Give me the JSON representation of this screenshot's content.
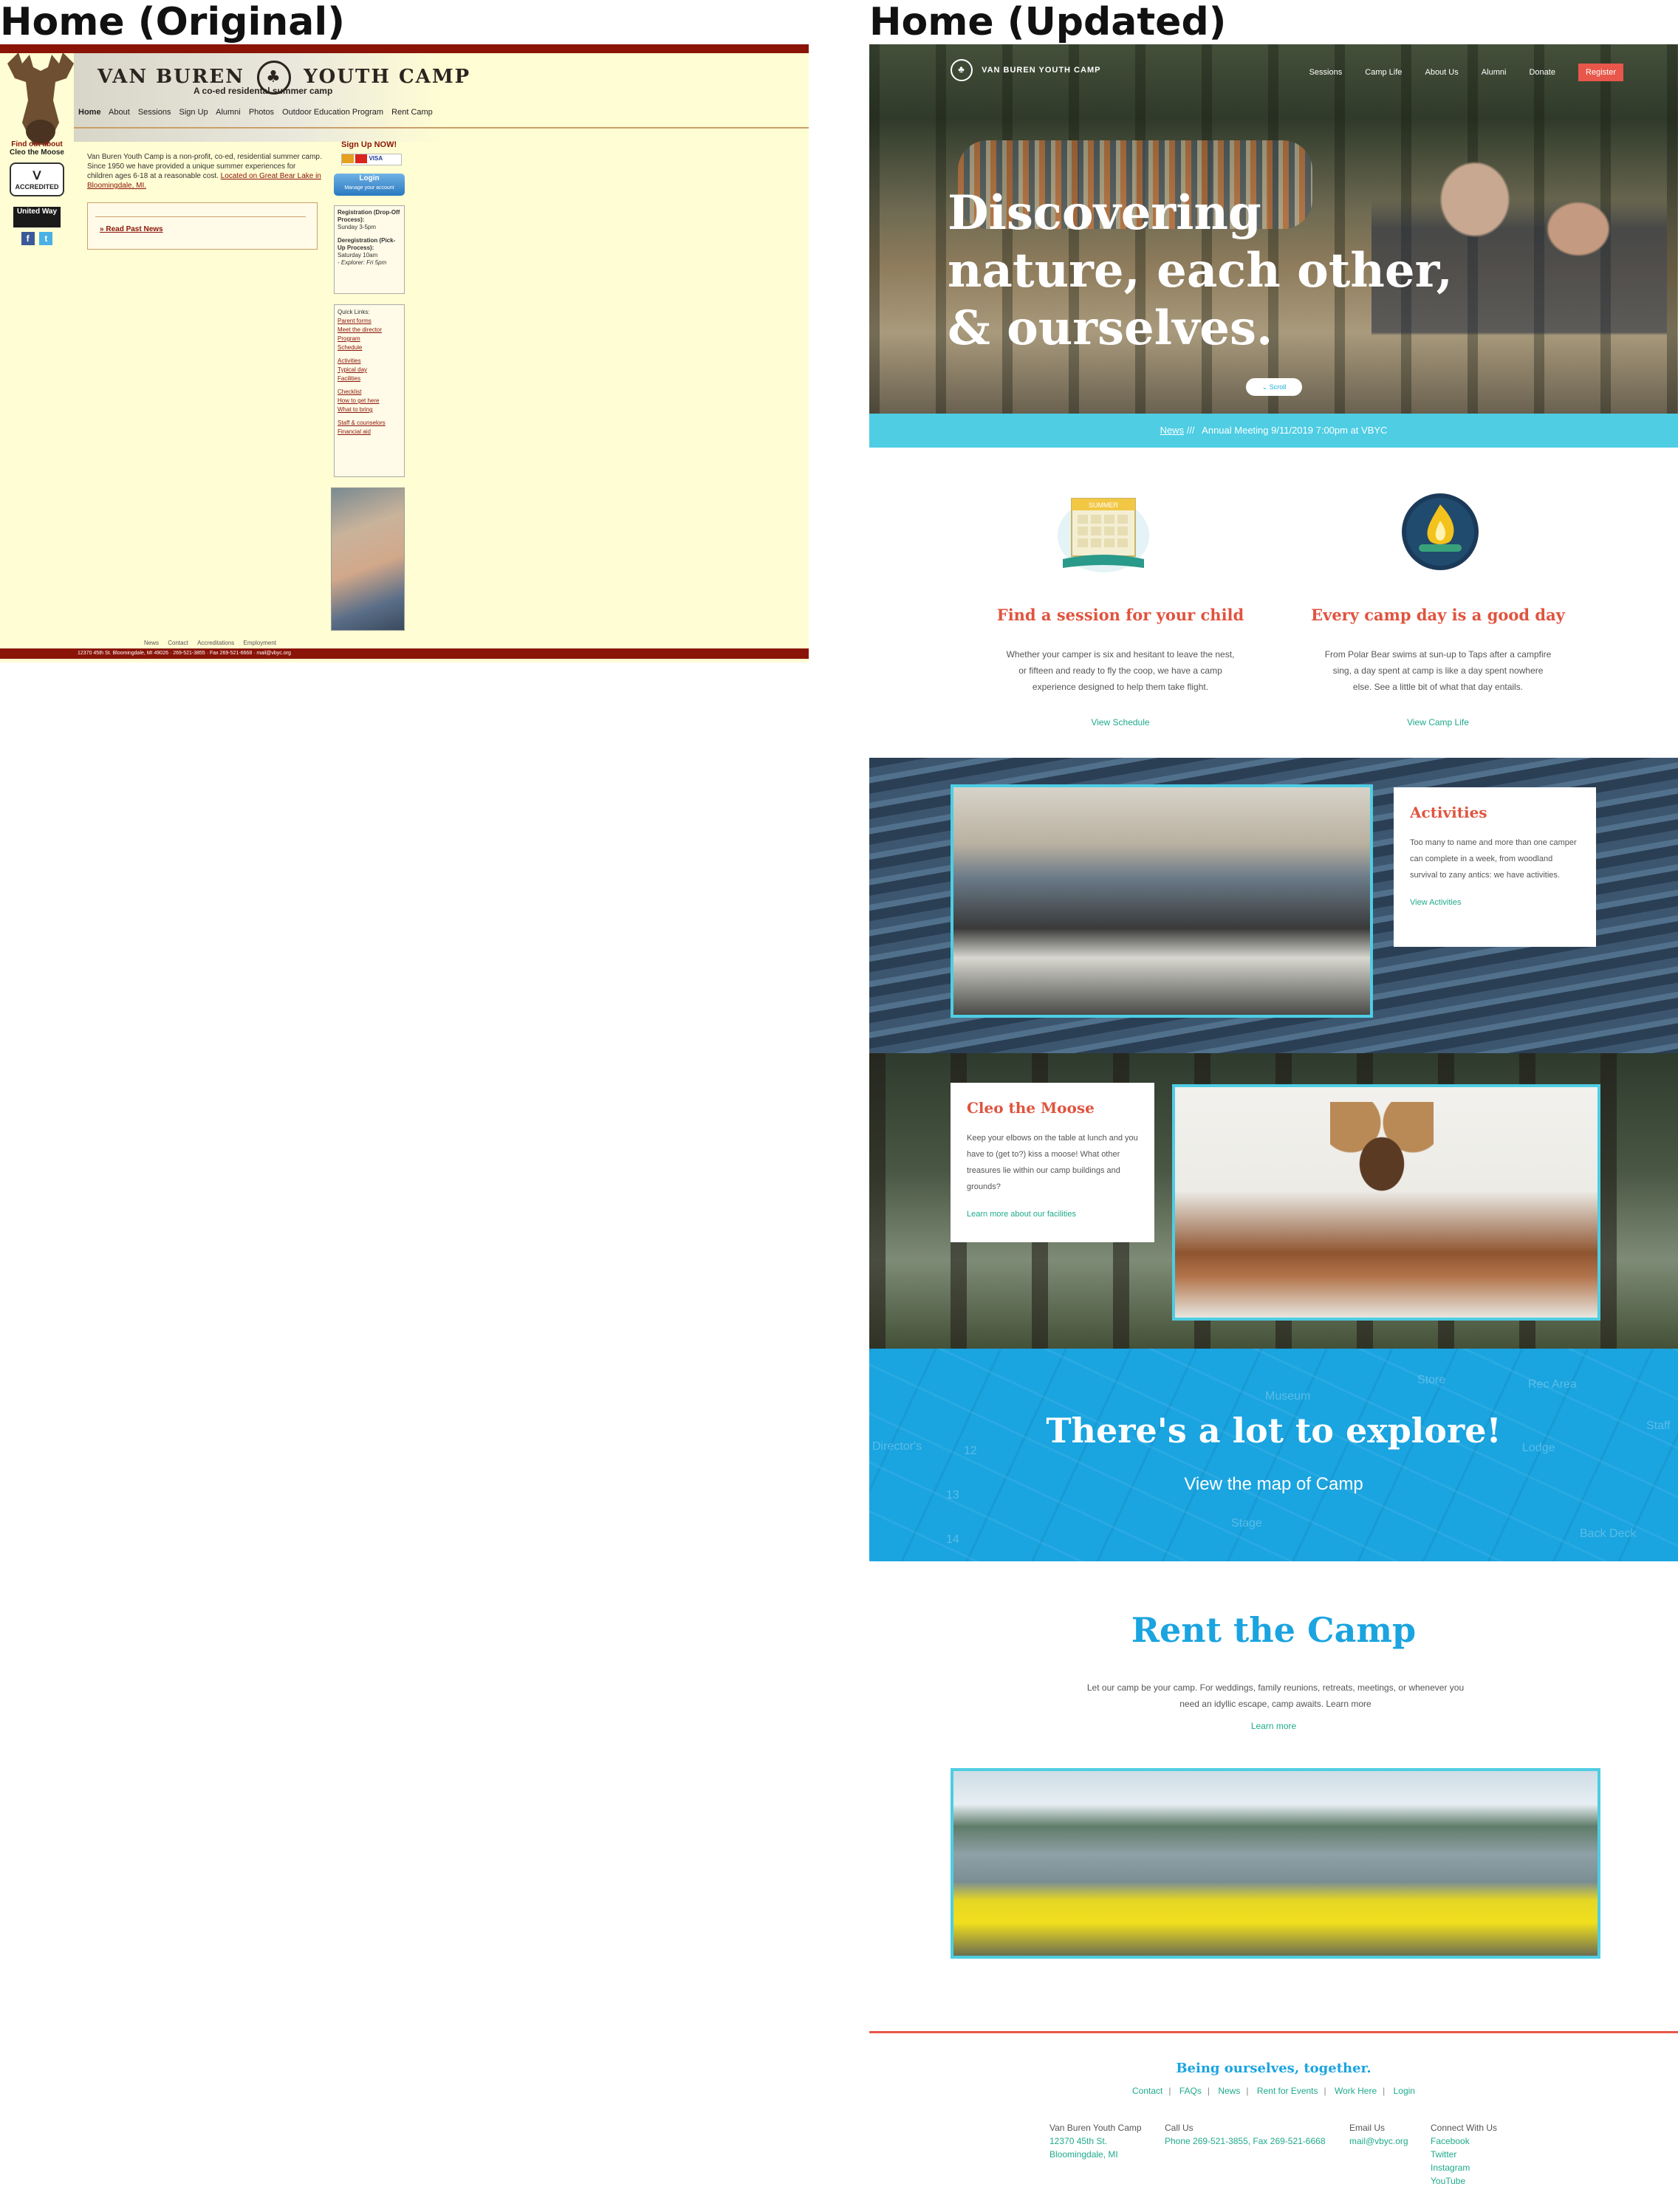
{
  "labels": {
    "original": "Home (Original)",
    "updated": "Home (Updated)"
  },
  "original": {
    "logo_left": "VAN BUREN",
    "logo_right": "YOUTH CAMP",
    "tagline": "A co-ed residental summer camp",
    "nav": [
      "Home",
      "About",
      "Sessions",
      "Sign Up",
      "Alumni",
      "Photos",
      "Outdoor Education Program",
      "Rent Camp"
    ],
    "find_out": "Find out about",
    "cleo": "Cleo the Moose",
    "acc_badge": "ACCREDITED",
    "united_way": "United Way",
    "intro_text": "Van Buren Youth Camp is a non-profit, co-ed, residential summer camp. Since 1950 we have provided a unique summer experiences for children ages 6-18 at a reasonable cost.",
    "intro_link": "Located on Great Bear Lake in Bloomingdale, MI.",
    "read_past": "Read Past News",
    "signup": "Sign Up NOW!",
    "cards": "VISA",
    "login": "Login",
    "manage": "Manage your account",
    "reg_title": "Registration (Drop-Off Process):",
    "reg_time": "Sunday 3-5pm",
    "dereg_title": "Deregistration (Pick-Up Process):",
    "dereg_time": "Saturday 10am",
    "explorer": "- Explorer: Fri 5pm",
    "quick_title": "Quick Links:",
    "quick_links": [
      "Parent forms",
      "Meet the director",
      "Program",
      "Schedule",
      "Activities",
      "Typical day",
      "Facilities",
      "Checklist",
      "How to get here",
      "What to bring",
      "Staff & counselors",
      "Financial aid"
    ],
    "footer_links": [
      "News",
      "Contact",
      "Accreditations",
      "Employment"
    ],
    "footer_address": "12370 45th St. Bloomingdale, MI 49026 · 269-521-3855 · Fax 269-521-6668 · mail@vbyc.org"
  },
  "updated": {
    "logo": "VAN BUREN YOUTH CAMP",
    "nav": [
      "Sessions",
      "Camp Life",
      "About Us",
      "Alumni",
      "Donate"
    ],
    "register": "Register",
    "headline": "Discovering nature, each other, & ourselves.",
    "scroll": "Scroll",
    "news_label": "News",
    "news_sep": "///",
    "news_text": "Annual Meeting 9/11/2019 7:00pm at VBYC",
    "cal_banner": "SUMMER",
    "f1_title": "Find a session for your child",
    "f1_text": "Whether your camper is six and hesitant to leave the nest, or fifteen and ready to fly the coop, we have a camp experience designed to help them take flight.",
    "f1_link": "View Schedule",
    "f2_title": "Every camp day is a good day",
    "f2_text": "From Polar Bear swims at sun-up to Taps after a campfire sing, a day spent at camp is like a day spent nowhere else. See a little bit of what that day entails.",
    "f2_link": "View Camp Life",
    "act_title": "Activities",
    "act_text": "Too many to name and more than one camper can complete in a week, from woodland survival to zany antics: we have activities.",
    "act_link": "View Activities",
    "cleo_title": "Cleo the Moose",
    "cleo_text": "Keep your elbows on the table at lunch and you have to (get to?) kiss a moose! What other treasures lie within our camp buildings and grounds?",
    "cleo_link": "Learn more about our facilities",
    "map_labels": [
      "Museum",
      "Store",
      "Rec Area",
      "Lodge",
      "Staff",
      "Stage",
      "Back Deck",
      "Director's",
      "12",
      "13",
      "14"
    ],
    "explore": "There's a lot to explore!",
    "map_link": "View the map of Camp",
    "rent_title": "Rent the Camp",
    "rent_text": "Let our camp be your camp. For weddings, family reunions, retreats, meetings, or whenever you need an idyllic escape, camp awaits. Learn more",
    "rent_link": "Learn more",
    "tagline": "Being ourselves, together.",
    "footer_links": [
      "Contact",
      "FAQs",
      "News",
      "Rent for Events",
      "Work Here",
      "Login"
    ],
    "foot_camp": "Van Buren Youth Camp",
    "foot_street": "12370 45th St.",
    "foot_city": "Bloomingdale, MI",
    "foot_call_h": "Call Us",
    "foot_call": "Phone 269-521-3855, Fax 269-521-6668",
    "foot_email_h": "Email Us",
    "foot_email": "mail@vbyc.org",
    "foot_connect_h": "Connect With Us",
    "foot_social": [
      "Facebook",
      "Twitter",
      "Instagram",
      "YouTube"
    ]
  },
  "colors": {
    "maroon": "#8a1408",
    "cream": "#fffdd3",
    "teal": "#4ecde3",
    "blue": "#1aa4e0",
    "coral": "#e0543f",
    "green_link": "#1faa8c"
  }
}
